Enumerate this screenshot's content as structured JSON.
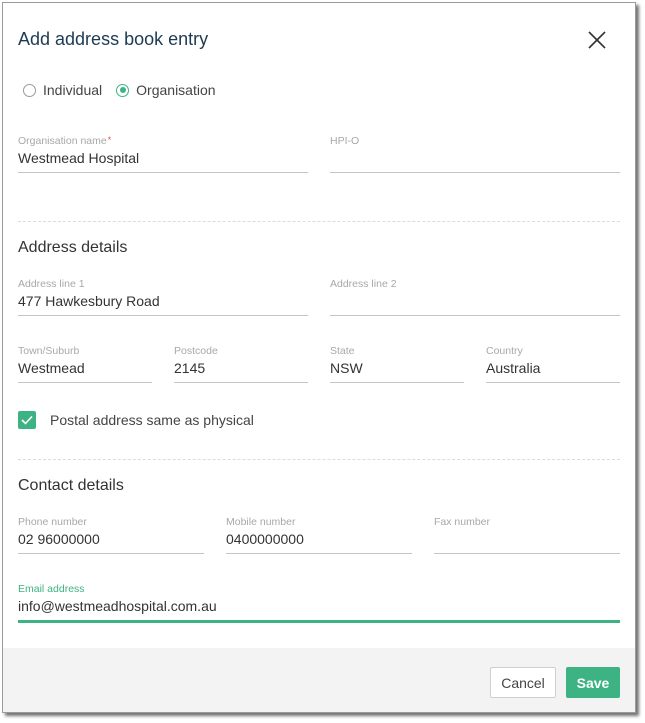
{
  "dialog": {
    "title": "Add address book entry",
    "close_icon": "close-icon"
  },
  "entry_type": {
    "options": [
      {
        "label": "Individual",
        "selected": false
      },
      {
        "label": "Organisation",
        "selected": true
      }
    ]
  },
  "organisation": {
    "name_label": "Organisation name",
    "name_required_marker": "*",
    "name_value": "Westmead Hospital",
    "hpio_label": "HPI-O",
    "hpio_value": ""
  },
  "address": {
    "heading": "Address details",
    "line1_label": "Address line 1",
    "line1_value": "477 Hawkesbury Road",
    "line2_label": "Address line 2",
    "line2_value": "",
    "town_label": "Town/Suburb",
    "town_value": "Westmead",
    "postcode_label": "Postcode",
    "postcode_value": "2145",
    "state_label": "State",
    "state_value": "NSW",
    "country_label": "Country",
    "country_value": "Australia",
    "postal_same_label": "Postal address same as physical",
    "postal_same_checked": true
  },
  "contact": {
    "heading": "Contact details",
    "phone_label": "Phone number",
    "phone_value": "02 96000000",
    "mobile_label": "Mobile number",
    "mobile_value": "0400000000",
    "fax_label": "Fax number",
    "fax_value": "",
    "email_label": "Email address",
    "email_value": "info@westmeadhospital.com.au"
  },
  "footer": {
    "cancel_label": "Cancel",
    "save_label": "Save"
  },
  "colors": {
    "accent": "#3db384",
    "title": "#1d3a52",
    "required": "#d9534f"
  }
}
